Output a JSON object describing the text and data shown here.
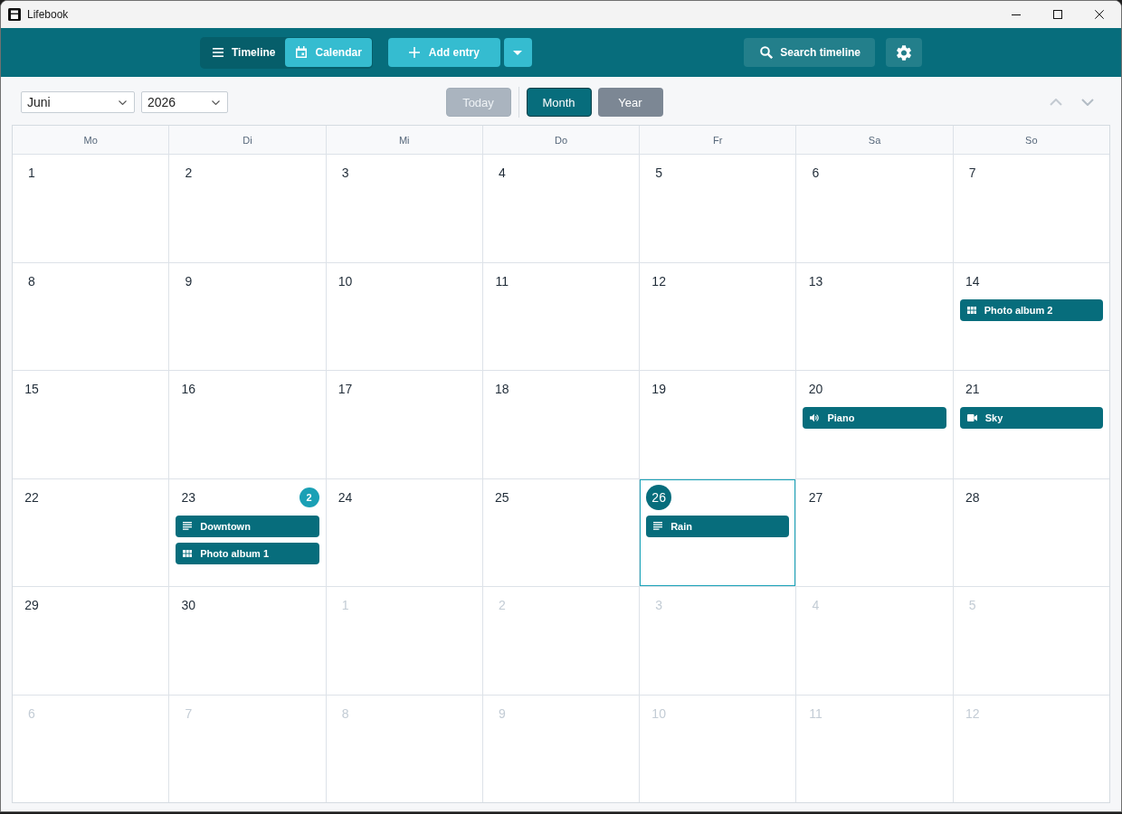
{
  "window": {
    "title": "Lifebook"
  },
  "toolbar": {
    "view_tabs": [
      {
        "label": "Timeline",
        "kind": "timeline",
        "selected": false
      },
      {
        "label": "Calendar",
        "kind": "calendar",
        "selected": true
      }
    ],
    "add_button": "Add entry",
    "search_button": "Search timeline"
  },
  "navigation": {
    "month_select": "Juni",
    "year_select": "2026",
    "today_button": {
      "label": "Today",
      "disabled": true
    },
    "range_tabs": [
      {
        "label": "Month",
        "selected": true
      },
      {
        "label": "Year",
        "selected": false
      }
    ]
  },
  "calendar": {
    "weekdays": [
      "Mo",
      "Di",
      "Mi",
      "Do",
      "Fr",
      "Sa",
      "So"
    ],
    "days": [
      {
        "day": "1",
        "in_month": true,
        "selected": false,
        "today": false
      },
      {
        "day": "2",
        "in_month": true,
        "selected": false,
        "today": false
      },
      {
        "day": "3",
        "in_month": true,
        "selected": false,
        "today": false
      },
      {
        "day": "4",
        "in_month": true,
        "selected": false,
        "today": false
      },
      {
        "day": "5",
        "in_month": true,
        "selected": false,
        "today": false
      },
      {
        "day": "6",
        "in_month": true,
        "selected": false,
        "today": false
      },
      {
        "day": "7",
        "in_month": true,
        "selected": false,
        "today": false
      },
      {
        "day": "8",
        "in_month": true,
        "selected": false,
        "today": false
      },
      {
        "day": "9",
        "in_month": true,
        "selected": false,
        "today": false
      },
      {
        "day": "10",
        "in_month": true,
        "selected": false,
        "today": false
      },
      {
        "day": "11",
        "in_month": true,
        "selected": false,
        "today": false
      },
      {
        "day": "12",
        "in_month": true,
        "selected": false,
        "today": false
      },
      {
        "day": "13",
        "in_month": true,
        "selected": false,
        "today": false
      },
      {
        "day": "14",
        "in_month": true,
        "selected": false,
        "today": false,
        "entries": [
          {
            "title": "Photo album 2",
            "kind": "album"
          }
        ]
      },
      {
        "day": "15",
        "in_month": true,
        "selected": false,
        "today": false
      },
      {
        "day": "16",
        "in_month": true,
        "selected": false,
        "today": false
      },
      {
        "day": "17",
        "in_month": true,
        "selected": false,
        "today": false
      },
      {
        "day": "18",
        "in_month": true,
        "selected": false,
        "today": false
      },
      {
        "day": "19",
        "in_month": true,
        "selected": false,
        "today": false
      },
      {
        "day": "20",
        "in_month": true,
        "selected": false,
        "today": false,
        "entries": [
          {
            "title": "Piano",
            "kind": "audio"
          }
        ]
      },
      {
        "day": "21",
        "in_month": true,
        "selected": false,
        "today": false,
        "entries": [
          {
            "title": "Sky",
            "kind": "video"
          }
        ]
      },
      {
        "day": "22",
        "in_month": true,
        "selected": false,
        "today": false
      },
      {
        "day": "23",
        "in_month": true,
        "selected": false,
        "today": false,
        "count": "2",
        "entries": [
          {
            "title": "Downtown",
            "kind": "text"
          },
          {
            "title": "Photo album 1",
            "kind": "album"
          }
        ]
      },
      {
        "day": "24",
        "in_month": true,
        "selected": false,
        "today": false
      },
      {
        "day": "25",
        "in_month": true,
        "selected": false,
        "today": false
      },
      {
        "day": "26",
        "in_month": true,
        "selected": true,
        "today": true,
        "entries": [
          {
            "title": "Rain",
            "kind": "text"
          }
        ]
      },
      {
        "day": "27",
        "in_month": true,
        "selected": false,
        "today": false
      },
      {
        "day": "28",
        "in_month": true,
        "selected": false,
        "today": false
      },
      {
        "day": "29",
        "in_month": true,
        "selected": false,
        "today": false
      },
      {
        "day": "30",
        "in_month": true,
        "selected": false,
        "today": false
      },
      {
        "day": "1",
        "in_month": false,
        "selected": false,
        "today": false
      },
      {
        "day": "2",
        "in_month": false,
        "selected": false,
        "today": false
      },
      {
        "day": "3",
        "in_month": false,
        "selected": false,
        "today": false
      },
      {
        "day": "4",
        "in_month": false,
        "selected": false,
        "today": false
      },
      {
        "day": "5",
        "in_month": false,
        "selected": false,
        "today": false
      },
      {
        "day": "6",
        "in_month": false,
        "selected": false,
        "today": false
      },
      {
        "day": "7",
        "in_month": false,
        "selected": false,
        "today": false
      },
      {
        "day": "8",
        "in_month": false,
        "selected": false,
        "today": false
      },
      {
        "day": "9",
        "in_month": false,
        "selected": false,
        "today": false
      },
      {
        "day": "10",
        "in_month": false,
        "selected": false,
        "today": false
      },
      {
        "day": "11",
        "in_month": false,
        "selected": false,
        "today": false
      },
      {
        "day": "12",
        "in_month": false,
        "selected": false,
        "today": false
      }
    ]
  }
}
